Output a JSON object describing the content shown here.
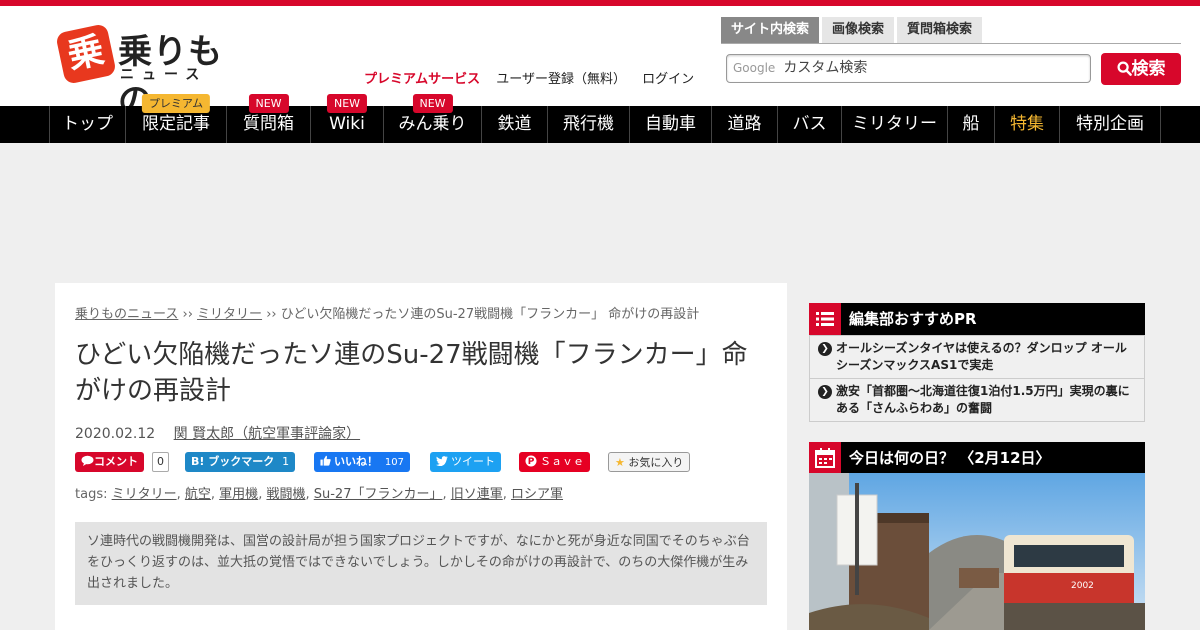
{
  "logo": {
    "main": "乗りもの",
    "sub": "ニュース",
    "badge": "乗"
  },
  "header": {
    "premium_label": "プレミアムサービス",
    "register_label": "ユーザー登録（無料）",
    "login_label": "ログイン"
  },
  "search": {
    "tabs": [
      "サイト内検索",
      "画像検索",
      "質問箱検索"
    ],
    "google_label": "Google",
    "placeholder": "カスタム検索",
    "button_label": "検索"
  },
  "nav": {
    "items": [
      {
        "label": "トップ",
        "badge": ""
      },
      {
        "label": "限定記事",
        "badge": "プレミアム"
      },
      {
        "label": "質問箱",
        "badge": "NEW"
      },
      {
        "label": "Wiki",
        "badge": "NEW"
      },
      {
        "label": "みん乗り",
        "badge": "NEW"
      },
      {
        "label": "鉄道",
        "badge": ""
      },
      {
        "label": "飛行機",
        "badge": ""
      },
      {
        "label": "自動車",
        "badge": ""
      },
      {
        "label": "道路",
        "badge": ""
      },
      {
        "label": "バス",
        "badge": ""
      },
      {
        "label": "ミリタリー",
        "badge": ""
      },
      {
        "label": "船",
        "badge": ""
      },
      {
        "label": "特集",
        "badge": ""
      },
      {
        "label": "特別企画",
        "badge": ""
      }
    ]
  },
  "article": {
    "breadcrumb": {
      "home": "乗りものニュース",
      "sep": "››",
      "category": "ミリタリー",
      "current": "ひどい欠陥機だったソ連のSu-27戦闘機「フランカー」 命がけの再設計"
    },
    "title": "ひどい欠陥機だったソ連のSu-27戦闘機「フランカー」命がけの再設計",
    "date": "2020.02.12",
    "author": "関 賢太郎（航空軍事評論家）",
    "social": {
      "comment_label": "コメント",
      "comment_count": "0",
      "hatena_label": "B! ブックマーク",
      "hatena_count": "1",
      "like_label": "いいね！",
      "like_count": "107",
      "tweet_label": "ツイート",
      "save_label": "Ｓａｖｅ",
      "fav_label": "お気に入り"
    },
    "tags_label": "tags:",
    "tags": [
      "ミリタリー",
      "航空",
      "軍用機",
      "戦闘機",
      "Su-27「フランカー」",
      "旧ソ連軍",
      "ロシア軍"
    ],
    "lead": "ソ連時代の戦闘機開発は、国営の設計局が担う国家プロジェクトですが、なにかと死が身近な同国でそのちゃぶ台をひっくり返すのは、並大抵の覚悟ではできないでしょう。しかしその命がけの再設計で、のちの大傑作機が生み出されました。"
  },
  "sidebar": {
    "pr_title": "編集部おすすめPR",
    "pr_items": [
      "オールシーズンタイヤは使えるの？ダンロップ オールシーズンマックスAS1で実走",
      "激安「首都圏～北海道往復1泊付1.5万円」実現の裏にある「さんふらわあ」の奮闘"
    ],
    "today_title": "今日は何の日？ 〈2月12日〉",
    "train_number": "2002"
  },
  "colors": {
    "brand_red": "#d7072b",
    "nav_bg": "#000000",
    "premium_yellow": "#f5b731"
  }
}
